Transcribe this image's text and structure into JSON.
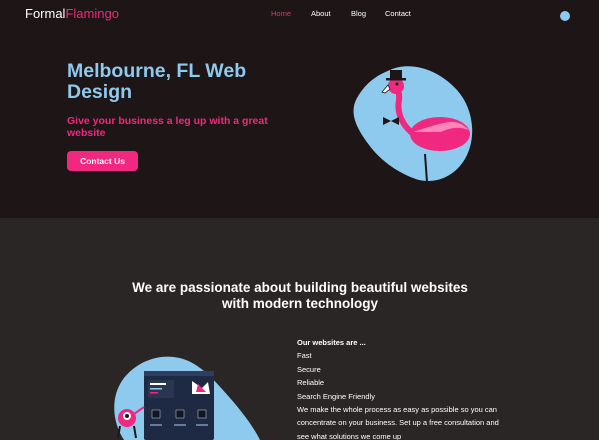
{
  "header": {
    "logo_part1": "Formal",
    "logo_part2": "Flamingo",
    "nav": [
      {
        "label": "Home",
        "active": true
      },
      {
        "label": "About",
        "active": false
      },
      {
        "label": "Blog",
        "active": false
      },
      {
        "label": "Contact",
        "active": false
      }
    ]
  },
  "hero": {
    "title": "Melbourne, FL Web Design",
    "subtitle": "Give your business a leg up with a great website",
    "cta_label": "Contact Us",
    "illustration": "flamingo-with-top-hat"
  },
  "section": {
    "title": "We are passionate about building beautiful websites with modern technology",
    "features_heading": "Our websites are ...",
    "features": [
      "Fast",
      "Secure",
      "Reliable",
      "Search Engine Friendly"
    ],
    "paragraph": "We make the whole process as easy as possible so you can concentrate on your business. Set up a free consultation and see what solutions we come up",
    "illustration": "monster-with-website-mockup"
  },
  "colors": {
    "pink": "#f0287f",
    "light_blue": "#8ec9ee",
    "hero_bg": "#1e1616",
    "page_bg": "#2b2626"
  }
}
